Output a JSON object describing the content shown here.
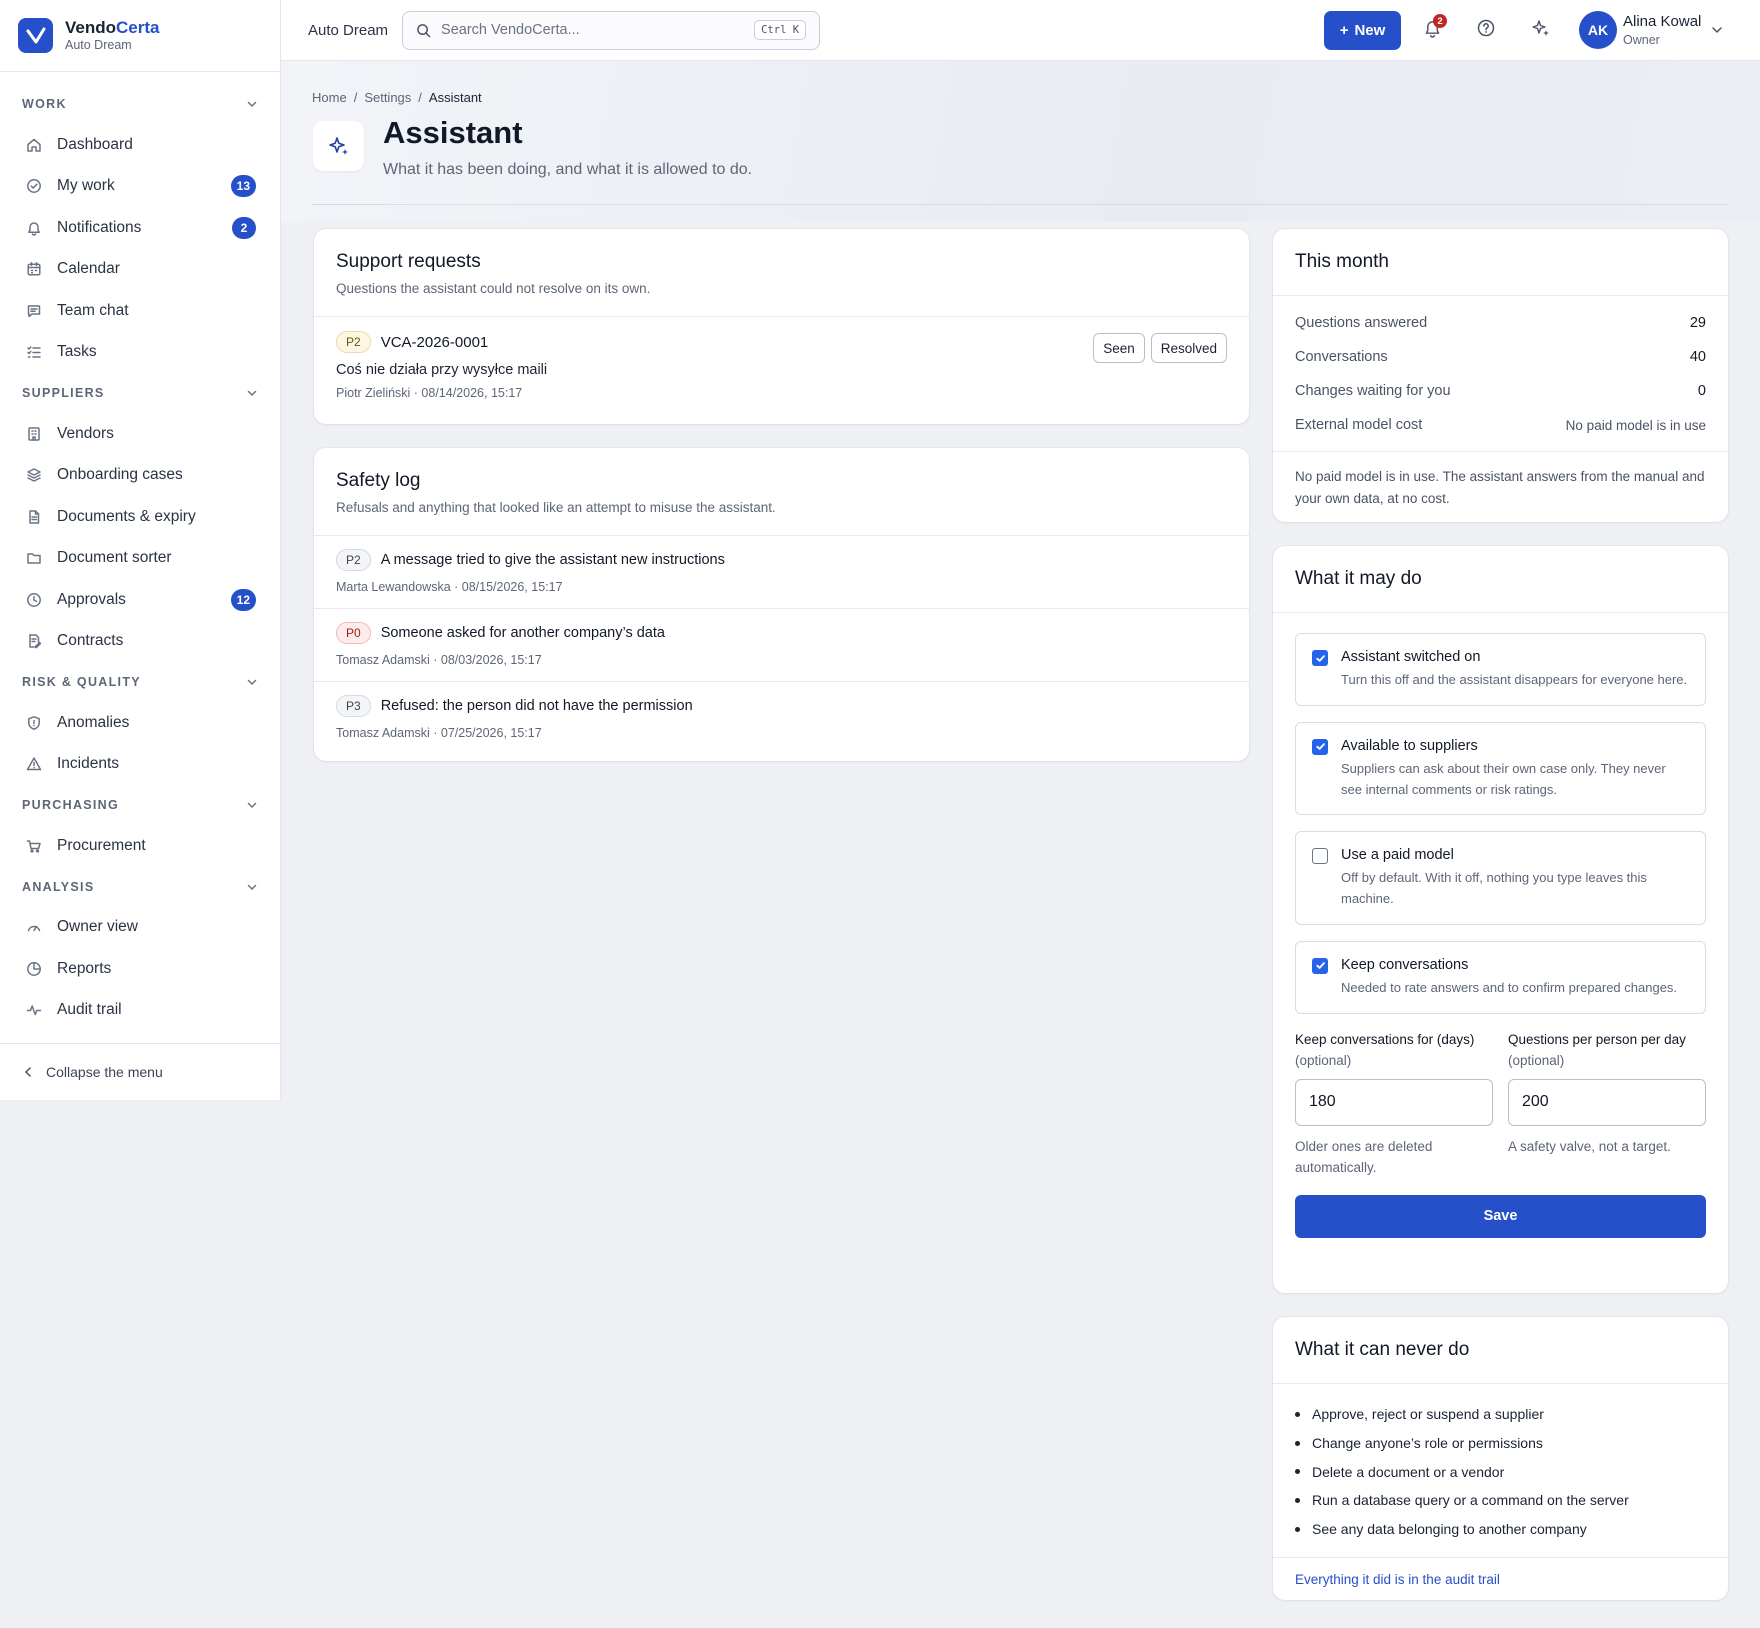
{
  "brand": {
    "name_main": "Vendo",
    "name_accent": "Certa",
    "org": "Auto Dream"
  },
  "sidebar": {
    "sections": [
      {
        "label": "WORK",
        "items": [
          {
            "label": "Dashboard",
            "icon": "home-icon"
          },
          {
            "label": "My work",
            "icon": "check-circle-icon",
            "badge": "13"
          },
          {
            "label": "Notifications",
            "icon": "bell-icon",
            "badge": "2"
          },
          {
            "label": "Calendar",
            "icon": "calendar-icon"
          },
          {
            "label": "Team chat",
            "icon": "chat-icon"
          },
          {
            "label": "Tasks",
            "icon": "list-check-icon"
          }
        ]
      },
      {
        "label": "SUPPLIERS",
        "items": [
          {
            "label": "Vendors",
            "icon": "building-icon"
          },
          {
            "label": "Onboarding cases",
            "icon": "layers-icon"
          },
          {
            "label": "Documents & expiry",
            "icon": "document-icon"
          },
          {
            "label": "Document sorter",
            "icon": "folder-icon"
          },
          {
            "label": "Approvals",
            "icon": "clock-icon",
            "badge": "12"
          },
          {
            "label": "Contracts",
            "icon": "contract-icon"
          }
        ]
      },
      {
        "label": "RISK & QUALITY",
        "items": [
          {
            "label": "Anomalies",
            "icon": "shield-icon"
          },
          {
            "label": "Incidents",
            "icon": "warning-triangle-icon"
          }
        ]
      },
      {
        "label": "PURCHASING",
        "items": [
          {
            "label": "Procurement",
            "icon": "cart-icon"
          }
        ]
      },
      {
        "label": "ANALYSIS",
        "items": [
          {
            "label": "Owner view",
            "icon": "gauge-icon"
          },
          {
            "label": "Reports",
            "icon": "pie-chart-icon"
          },
          {
            "label": "Audit trail",
            "icon": "activity-icon"
          }
        ]
      }
    ],
    "collapse_label": "Collapse the menu"
  },
  "topbar": {
    "org": "Auto Dream",
    "search_placeholder": "Search VendoCerta...",
    "search_shortcut": "Ctrl K",
    "new_label": "New",
    "notification_count": "2",
    "user": {
      "initials": "AK",
      "name": "Alina Kowal",
      "role": "Owner"
    }
  },
  "page": {
    "breadcrumb": [
      "Home",
      "Settings",
      "Assistant"
    ],
    "title": "Assistant",
    "subtitle": "What it has been doing, and what it is allowed to do."
  },
  "support": {
    "title": "Support requests",
    "desc": "Questions the assistant could not resolve on its own.",
    "items": [
      {
        "priority": "P2",
        "id": "VCA-2026-0001",
        "text": "Coś nie działa przy wysyłce maili",
        "meta": "Piotr Zieliński · 08/14/2026, 15:17",
        "seen_label": "Seen",
        "resolved_label": "Resolved"
      }
    ]
  },
  "safety": {
    "title": "Safety log",
    "desc": "Refusals and anything that looked like an attempt to misuse the assistant.",
    "items": [
      {
        "priority": "P2",
        "text": "A message tried to give the assistant new instructions",
        "meta": "Marta Lewandowska · 08/15/2026, 15:17"
      },
      {
        "priority": "P0",
        "text": "Someone asked for another company’s data",
        "meta": "Tomasz Adamski · 08/03/2026, 15:17"
      },
      {
        "priority": "P3",
        "text": "Refused: the person did not have the permission",
        "meta": "Tomasz Adamski · 07/25/2026, 15:17"
      }
    ]
  },
  "month": {
    "title": "This month",
    "rows": [
      {
        "label": "Questions answered",
        "value": "29"
      },
      {
        "label": "Conversations",
        "value": "40"
      },
      {
        "label": "Changes waiting for you",
        "value": "0"
      },
      {
        "label": "External model cost",
        "value": "No paid model is in use"
      }
    ],
    "note": "No paid model is in use. The assistant answers from the manual and your own data, at no cost."
  },
  "permissions": {
    "title": "What it may do",
    "items": [
      {
        "title": "Assistant switched on",
        "desc": "Turn this off and the assistant disappears for everyone here.",
        "checked": true
      },
      {
        "title": "Available to suppliers",
        "desc": "Suppliers can ask about their own case only. They never see internal comments or risk ratings.",
        "checked": true
      },
      {
        "title": "Use a paid model",
        "desc": "Off by default. With it off, nothing you type leaves this machine.",
        "checked": false
      },
      {
        "title": "Keep conversations",
        "desc": "Needed to rate answers and to confirm prepared changes.",
        "checked": true
      }
    ],
    "retention": {
      "label": "Keep conversations for (days)",
      "optional": "(optional)",
      "value": "180",
      "help": "Older ones are deleted automatically."
    },
    "quota": {
      "label": "Questions per person per day",
      "optional": "(optional)",
      "value": "200",
      "help": "A safety valve, not a target."
    },
    "save_label": "Save"
  },
  "never": {
    "title": "What it can never do",
    "items": [
      "Approve, reject or suspend a supplier",
      "Change anyone’s role or permissions",
      "Delete a document or a vendor",
      "Run a database query or a command on the server",
      "See any data belonging to another company"
    ],
    "link": "Everything it did is in the audit trail"
  },
  "colors": {
    "accent": "#2550c9",
    "checkbox": "#2563eb",
    "danger": "#c02626"
  }
}
